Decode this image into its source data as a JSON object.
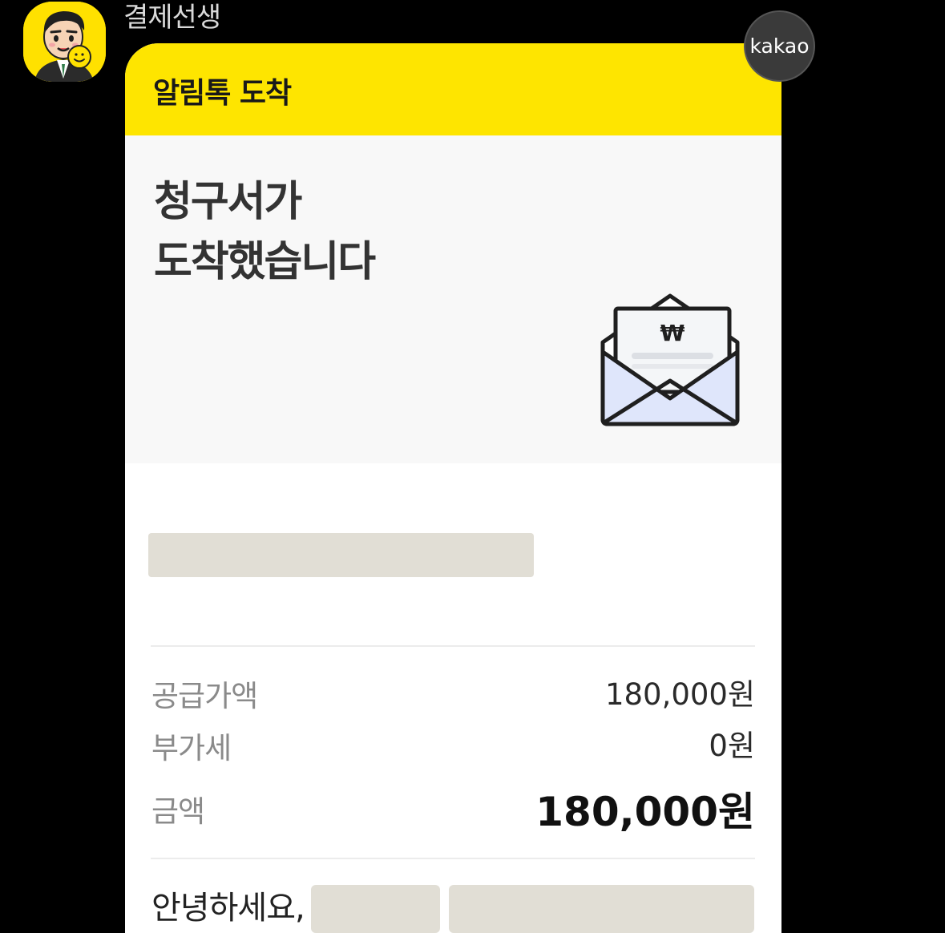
{
  "sender": {
    "name": "결제선생",
    "avatar_icon": "smiling-man-character-avatar"
  },
  "badge": {
    "label": "kakao"
  },
  "card": {
    "header_title": "알림톡 도착",
    "hero": {
      "title_line1": "청구서가",
      "title_line2": "도착했습니다",
      "icon": "envelope-with-invoice-icon",
      "icon_symbol": "₩"
    },
    "rows": [
      {
        "label": "공급가액",
        "value": "180,000원"
      },
      {
        "label": "부가세",
        "value": "0원"
      },
      {
        "label": "금액",
        "value": "180,000원"
      }
    ],
    "greeting": "안녕하세요,"
  },
  "colors": {
    "kakao_yellow": "#FEE500",
    "redaction": "#E1DED5",
    "background": "#000000"
  }
}
